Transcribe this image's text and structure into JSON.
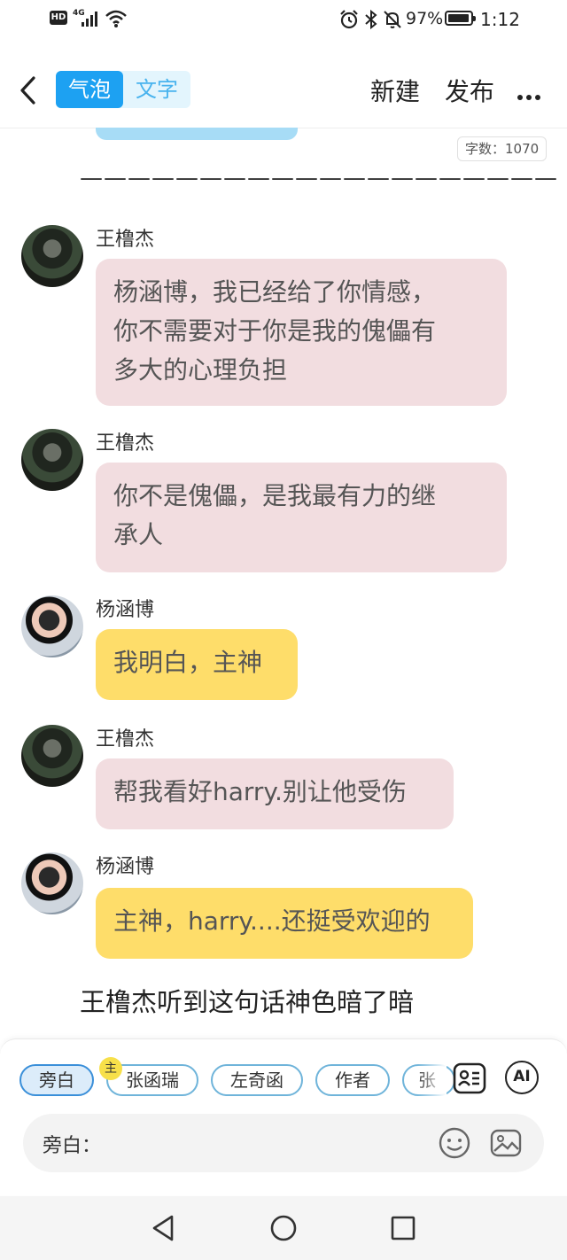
{
  "status_bar": {
    "network_badge": "HD",
    "signal_label": "4G",
    "battery_percent": "97%",
    "time": "1:12",
    "battery_level": 0.97,
    "icons": [
      "hd-icon",
      "signal-icon",
      "wifi-icon",
      "alarm-icon",
      "bluetooth-icon",
      "mute-icon",
      "battery-icon"
    ]
  },
  "header": {
    "back_icon": "chevron-left-icon",
    "tabs": [
      {
        "label": "气泡",
        "active": true
      },
      {
        "label": "文字",
        "active": false
      }
    ],
    "new_label": "新建",
    "publish_label": "发布",
    "more_icon": "more-horizontal-icon"
  },
  "editor": {
    "word_count": "字数：1070",
    "separator": "————————————————————",
    "narration": "王橹杰听到这句话神色暗了暗"
  },
  "messages": [
    {
      "speaker": "王橹杰",
      "text_lines": [
        "杨涵博，我已经给了你情感，",
        "你不需要对于你是我的傀儡有",
        "多大的心理负担"
      ]
    },
    {
      "speaker": "王橹杰",
      "text_lines": [
        "你不是傀儡，是我最有力的继",
        "承人"
      ]
    },
    {
      "speaker": "杨涵博",
      "text_lines": [
        "我明白，主神"
      ]
    },
    {
      "speaker": "王橹杰",
      "text_lines": [
        "帮我看好harry.别让他受伤"
      ]
    },
    {
      "speaker": "杨涵博",
      "text_lines": [
        "主神，harry....还挺受欢迎的"
      ]
    }
  ],
  "roles": {
    "chips": [
      "旁白",
      "张函瑞",
      "左奇函",
      "作者",
      "张"
    ],
    "selected": "旁白",
    "main_badge": "主",
    "contacts_icon": "contacts-card-icon",
    "ai_label": "AI"
  },
  "input": {
    "label": "旁白：",
    "emoji_icon": "emoji-icon",
    "image_icon": "image-icon"
  },
  "nav": {
    "icons": [
      "back-triangle-icon",
      "home-circle-icon",
      "recents-square-icon"
    ]
  },
  "colors": {
    "accent": "#1da1f2",
    "bubble_wang": "#f2dde0",
    "bubble_yang": "#fedd6a"
  }
}
